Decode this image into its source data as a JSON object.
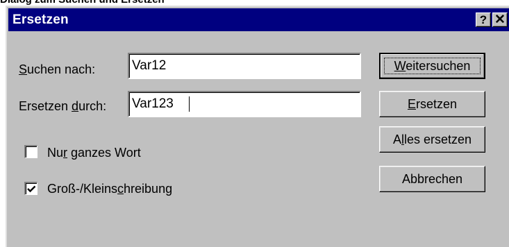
{
  "caption": "Dialog zum Suchen und Ersetzen",
  "window": {
    "title": "Ersetzen",
    "help_glyph": "?",
    "close_glyph": "✕"
  },
  "fields": {
    "search": {
      "label_pre": "",
      "label_key": "S",
      "label_post": "uchen nach:",
      "value": "Var12"
    },
    "replace": {
      "label_pre": "Ersetzen ",
      "label_key": "d",
      "label_post": "urch:",
      "value": "Var123"
    }
  },
  "checkboxes": {
    "whole_word": {
      "label_pre": "Nu",
      "label_key": "r",
      "label_post": " ganzes Wort",
      "checked": false
    },
    "match_case": {
      "label_pre": "Groß-/Kleins",
      "label_key": "c",
      "label_post": "hreibung",
      "checked": true
    }
  },
  "buttons": {
    "find_next": {
      "pre": "",
      "key": "W",
      "post": "eitersuchen"
    },
    "replace": {
      "pre": "",
      "key": "E",
      "post": "rsetzen"
    },
    "replace_all": {
      "pre": "A",
      "key": "l",
      "post": "les ersetzen"
    },
    "cancel": {
      "pre": "Abbrechen",
      "key": "",
      "post": ""
    }
  }
}
